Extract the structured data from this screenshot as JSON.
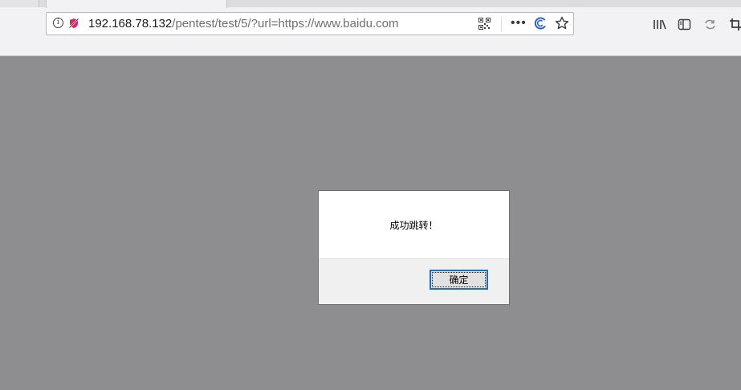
{
  "browser": {
    "url": {
      "host": "192.168.78.132",
      "path": "/pentest/test/5/?url=https://www.baidu.com"
    },
    "icons": {
      "info": "info-icon",
      "tracking": "tracking-protection-icon",
      "qr": "qr-code-icon",
      "more": "page-actions-icon",
      "pocket": "pocket-icon",
      "bookmark": "bookmark-star-icon",
      "library": "library-icon",
      "sidebar": "sidebar-icon",
      "sync": "sync-icon",
      "screenshot": "screenshot-icon"
    },
    "more_glyph": "•••",
    "info_glyph": "i"
  },
  "dialog": {
    "message": "成功跳转！",
    "ok_label": "确定"
  },
  "colors": {
    "page_overlay": "#8e8e90",
    "accent_focus": "#1f6fbf",
    "tracking_icon": "#e0245e"
  }
}
